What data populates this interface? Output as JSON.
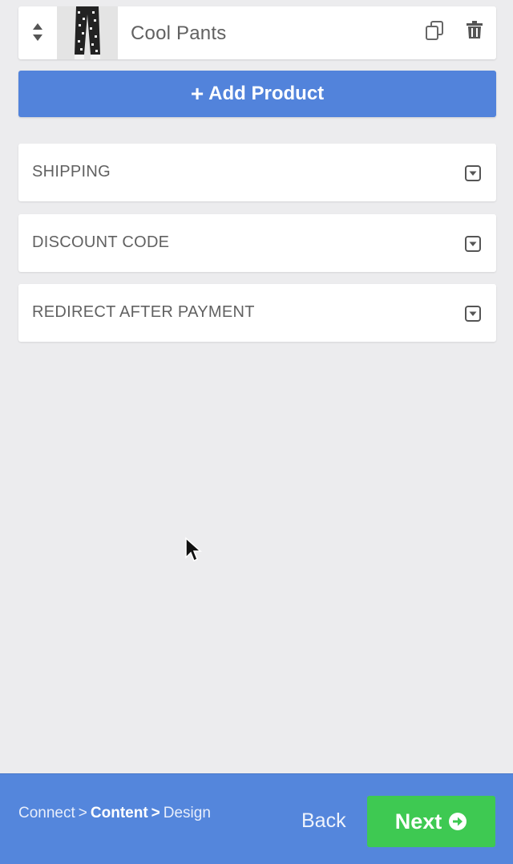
{
  "product": {
    "name": "Cool Pants",
    "sort_icon": "sort-arrows-icon",
    "duplicate_icon": "duplicate-icon",
    "delete_icon": "trash-icon"
  },
  "add_product": {
    "label": "Add Product",
    "icon": "plus-icon"
  },
  "sections": [
    {
      "label": "SHIPPING",
      "icon": "expand-toggle-icon"
    },
    {
      "label": "DISCOUNT CODE",
      "icon": "expand-toggle-icon"
    },
    {
      "label": "REDIRECT AFTER PAYMENT",
      "icon": "expand-toggle-icon"
    }
  ],
  "footer": {
    "breadcrumb": {
      "step1": "Connect",
      "step2": "Content",
      "step3": "Design",
      "separator": ">"
    },
    "back_label": "Back",
    "next_label": "Next",
    "next_icon": "arrow-circle-right-icon"
  },
  "colors": {
    "background": "#ececee",
    "accent_blue": "#5283db",
    "footer_blue": "#5486dc",
    "next_green": "#3ec952",
    "text_gray": "#616161"
  }
}
